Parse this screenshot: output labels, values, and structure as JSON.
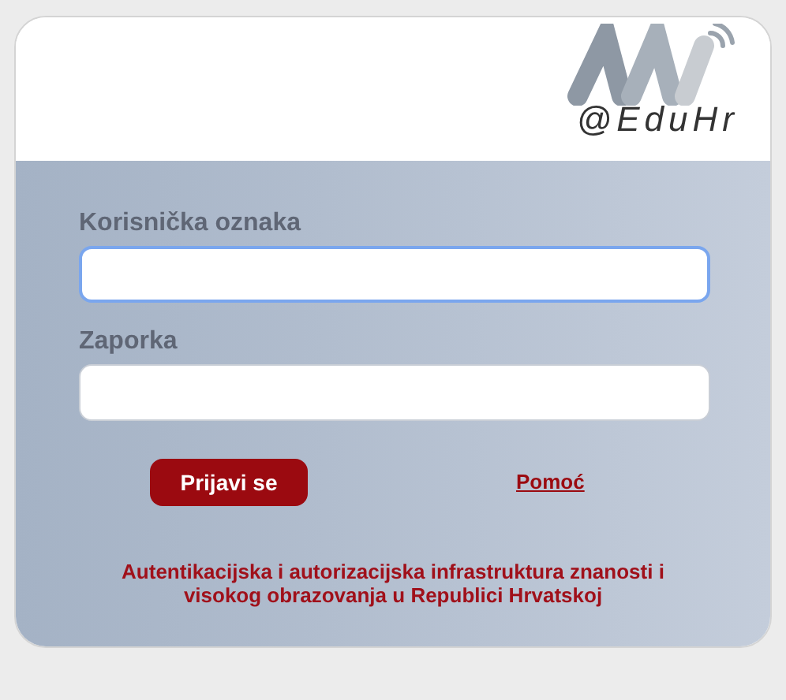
{
  "logo": {
    "text": "@EduHr"
  },
  "fields": [
    {
      "label": "Korisnička oznaka",
      "focused": true
    },
    {
      "label": "Zaporka",
      "focused": false
    }
  ],
  "login_button": "Prijavi se",
  "help_link": "Pomoć",
  "footer": "Autentikacijska i autorizacijska infrastruktura znanosti i visokog obrazovanja u Republici Hrvatskoj"
}
